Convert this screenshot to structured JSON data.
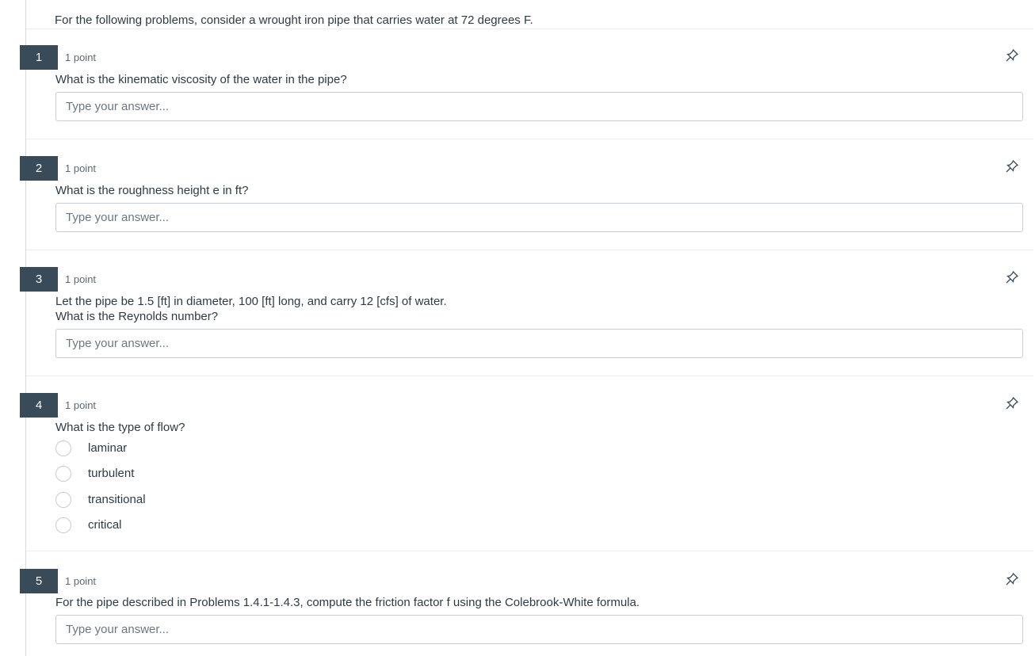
{
  "intro": "For the following problems, consider a wrought iron pipe that carries water at 72 degrees F.",
  "questions": [
    {
      "number": "1",
      "points": "1 point",
      "lines": [
        "What is the kinematic viscosity of the water in the pipe?"
      ],
      "placeholder": "Type your answer..."
    },
    {
      "number": "2",
      "points": "1 point",
      "lines": [
        "What is the roughness height e in ft?"
      ],
      "placeholder": "Type your answer..."
    },
    {
      "number": "3",
      "points": "1 point",
      "lines": [
        "Let the pipe be 1.5 [ft] in diameter, 100 [ft] long, and carry 12 [cfs] of water.",
        "What is the Reynolds number?"
      ],
      "placeholder": "Type your answer..."
    },
    {
      "number": "4",
      "points": "1 point",
      "lines": [
        "What is the type of flow?"
      ],
      "options": [
        "laminar",
        "turbulent",
        "transitional",
        "critical"
      ]
    },
    {
      "number": "5",
      "points": "1 point",
      "lines": [
        "For the pipe described in Problems 1.4.1-1.4.3, compute the friction factor f using the Colebrook-White formula."
      ],
      "placeholder": "Type your answer..."
    }
  ],
  "icons": {
    "pin": "pin-icon"
  },
  "colors": {
    "badge": "#394b58",
    "text": "#2d3b45",
    "border": "#c7cdd1"
  }
}
